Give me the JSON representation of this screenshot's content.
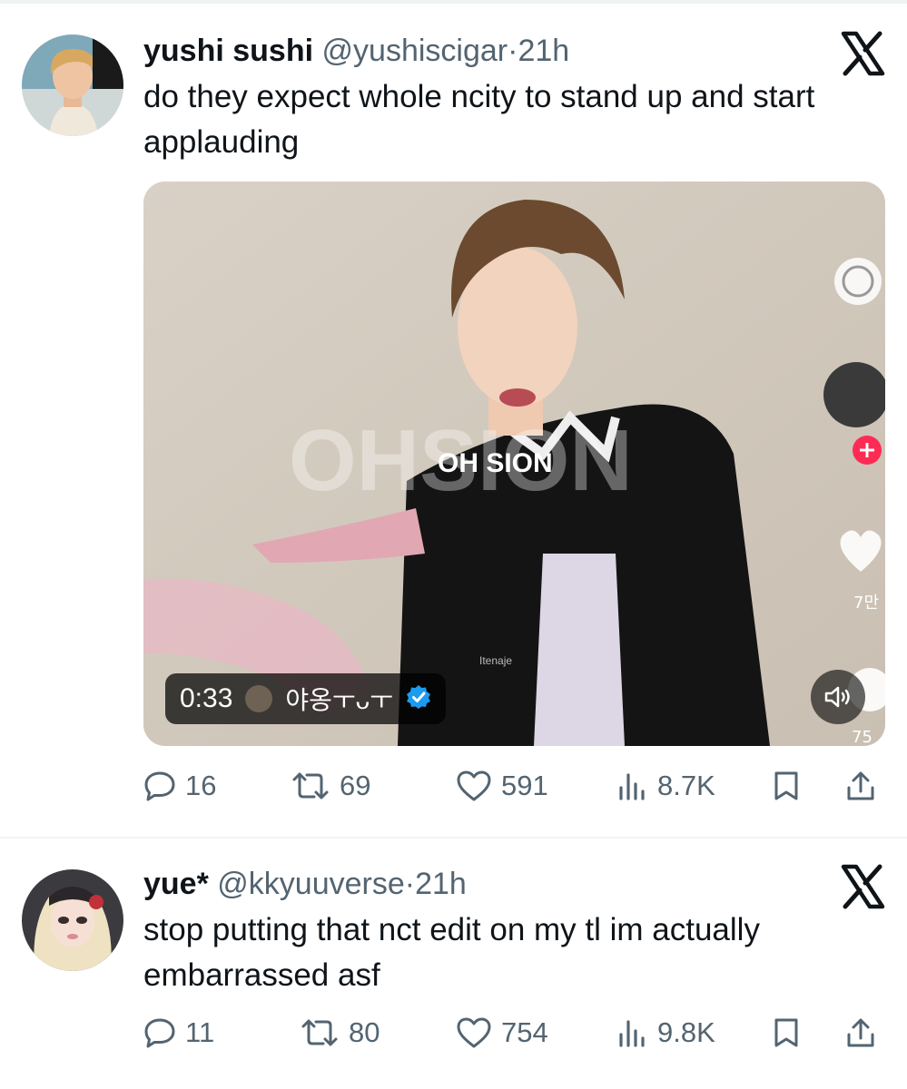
{
  "tweets": [
    {
      "name": "yushi sushi",
      "handle": "@yushiscigar",
      "separator": "·",
      "time": "21h",
      "text": "do they expect whole ncity to stand up and start applauding",
      "media": {
        "duration": "0:33",
        "uploader": "야옹ㅜᴗㅜ",
        "overlay_text": "OH SION",
        "bg_text": "OHSION",
        "watermark": "Itenaje",
        "side_counts": [
          "7만",
          "75"
        ]
      },
      "replies": "16",
      "reposts": "69",
      "likes": "591",
      "views": "8.7K"
    },
    {
      "name": "yue*",
      "handle": "@kkyuuverse",
      "separator": "·",
      "time": "21h",
      "text": "stop putting that nct edit on my tl im actually embarrassed asf",
      "replies": "11",
      "reposts": "80",
      "likes": "754",
      "views": "9.8K"
    }
  ],
  "icons": {
    "platform": "x-logo-icon",
    "reply": "speech-bubble-icon",
    "repost": "repost-arrows-icon",
    "like": "heart-icon",
    "views": "bar-chart-icon",
    "bookmark": "bookmark-icon",
    "share": "share-upload-icon",
    "verified": "verified-badge-icon",
    "volume": "speaker-icon"
  },
  "colors": {
    "text": "#0f1419",
    "secondary": "#536471",
    "verified": "#1d9bf0",
    "divider": "#eff3f4"
  }
}
